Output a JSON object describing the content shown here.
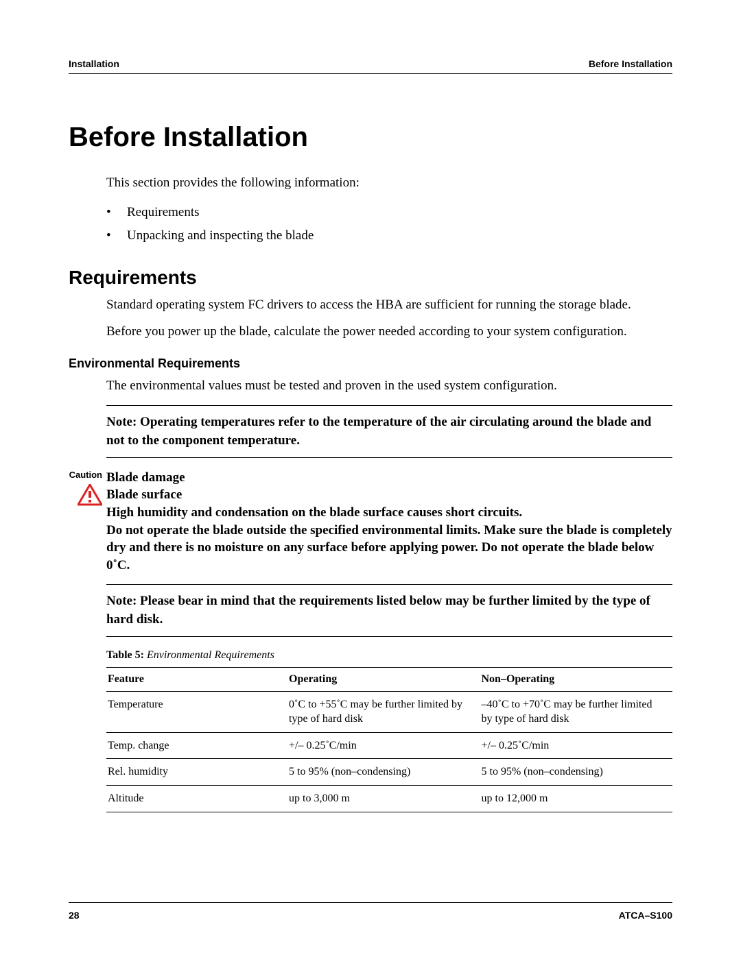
{
  "header": {
    "left": "Installation",
    "right": "Before Installation"
  },
  "title": "Before Installation",
  "intro": "This section provides the following information:",
  "bullets": [
    "Requirements",
    "Unpacking and inspecting the blade"
  ],
  "requirements": {
    "heading": "Requirements",
    "p1": "Standard operating system FC drivers to access the HBA are sufficient for running the storage blade.",
    "p2": "Before you power up the blade, calculate the power needed according to your system configuration."
  },
  "env": {
    "heading": "Environmental Requirements",
    "p1": "The environmental values must be tested and proven in the used system configuration."
  },
  "note1": "Note:  Operating temperatures refer to the temperature of the air circulating around the blade and not to the component temperature.",
  "caution": {
    "label": "Caution",
    "l1": "Blade damage",
    "l2": "Blade surface",
    "l3": "High humidity and condensation on the blade surface causes short circuits.",
    "l4": "Do not operate the blade outside the specified environmental limits. Make sure the blade is completely dry and there is no moisture on any surface before applying power. Do not operate the blade below 0˚C."
  },
  "note2": "Note:  Please bear in mind that the requirements listed below may be further limited by the type of hard disk.",
  "table": {
    "caption_label": "Table 5:",
    "caption_title": " Environmental Requirements",
    "headers": [
      "Feature",
      "Operating",
      "Non–Operating"
    ],
    "rows": [
      [
        "Temperature",
        "0˚C to +55˚C may be further limited by type of hard disk",
        "–40˚C to +70˚C may be further limited by type of hard disk"
      ],
      [
        "Temp. change",
        "+/– 0.25˚C/min",
        "+/– 0.25˚C/min"
      ],
      [
        "Rel. humidity",
        "5 to 95% (non–condensing)",
        "5 to 95% (non–condensing)"
      ],
      [
        "Altitude",
        "up to 3,000 m",
        "up to 12,000 m"
      ]
    ]
  },
  "footer": {
    "left": "28",
    "right": "ATCA–S100"
  }
}
